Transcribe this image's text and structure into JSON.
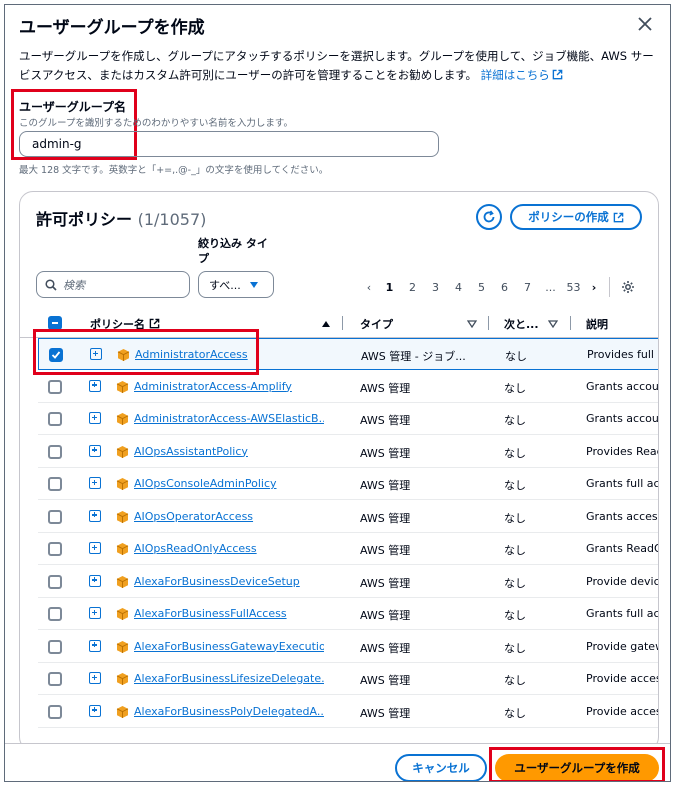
{
  "dialog": {
    "title": "ユーザーグループを作成",
    "description": "ユーザーグループを作成し、グループにアタッチするポリシーを選択します。グループを使用して、ジョブ機能、AWS サービスアクセス、またはカスタム許可別にユーザーの許可を管理することをお勧めします。",
    "learn_more": "詳細はこちら"
  },
  "group_name": {
    "label": "ユーザーグループ名",
    "description": "このグループを識別するためのわかりやすい名前を入力します。",
    "value": "admin-g",
    "hint": "最大 128 文字です。英数字と「+=,.@-_」の文字を使用してください。"
  },
  "policies": {
    "title": "許可ポリシー",
    "count": "(1/1057)",
    "create_policy_label": "ポリシーの作成",
    "filter_label": "絞り込み タイプ",
    "search_placeholder": "検索",
    "filter_value": "すべ...",
    "pagination": [
      "1",
      "2",
      "3",
      "4",
      "5",
      "6",
      "7",
      "...",
      "53"
    ],
    "columns": {
      "name": "ポリシー名",
      "type": "タイプ",
      "next": "次と...",
      "desc": "説明"
    },
    "rows": [
      {
        "name": "AdministratorAccess",
        "type": "AWS 管理 - ジョブ...",
        "next": "なし",
        "desc": "Provides full a"
      },
      {
        "name": "AdministratorAccess-Amplify",
        "type": "AWS 管理",
        "next": "なし",
        "desc": "Grants account"
      },
      {
        "name": "AdministratorAccess-AWSElasticB...",
        "type": "AWS 管理",
        "next": "なし",
        "desc": "Grants account"
      },
      {
        "name": "AIOpsAssistantPolicy",
        "type": "AWS 管理",
        "next": "なし",
        "desc": "Provides ReadO"
      },
      {
        "name": "AIOpsConsoleAdminPolicy",
        "type": "AWS 管理",
        "next": "なし",
        "desc": "Grants full acc"
      },
      {
        "name": "AIOpsOperatorAccess",
        "type": "AWS 管理",
        "next": "なし",
        "desc": "Grants access t"
      },
      {
        "name": "AIOpsReadOnlyAccess",
        "type": "AWS 管理",
        "next": "なし",
        "desc": "Grants ReadOn"
      },
      {
        "name": "AlexaForBusinessDeviceSetup",
        "type": "AWS 管理",
        "next": "なし",
        "desc": "Provide device"
      },
      {
        "name": "AlexaForBusinessFullAccess",
        "type": "AWS 管理",
        "next": "なし",
        "desc": "Grants full acc"
      },
      {
        "name": "AlexaForBusinessGatewayExecution",
        "type": "AWS 管理",
        "next": "なし",
        "desc": "Provide gatew"
      },
      {
        "name": "AlexaForBusinessLifesizeDelegate...",
        "type": "AWS 管理",
        "next": "なし",
        "desc": "Provide access"
      },
      {
        "name": "AlexaForBusinessPolyDelegatedA...",
        "type": "AWS 管理",
        "next": "なし",
        "desc": "Provide access"
      }
    ]
  },
  "footer": {
    "cancel_label": "キャンセル",
    "create_label": "ユーザーグループを作成"
  },
  "colors": {
    "link": "#0972d3",
    "primary": "#ff9900",
    "highlight": "#e0001b"
  }
}
